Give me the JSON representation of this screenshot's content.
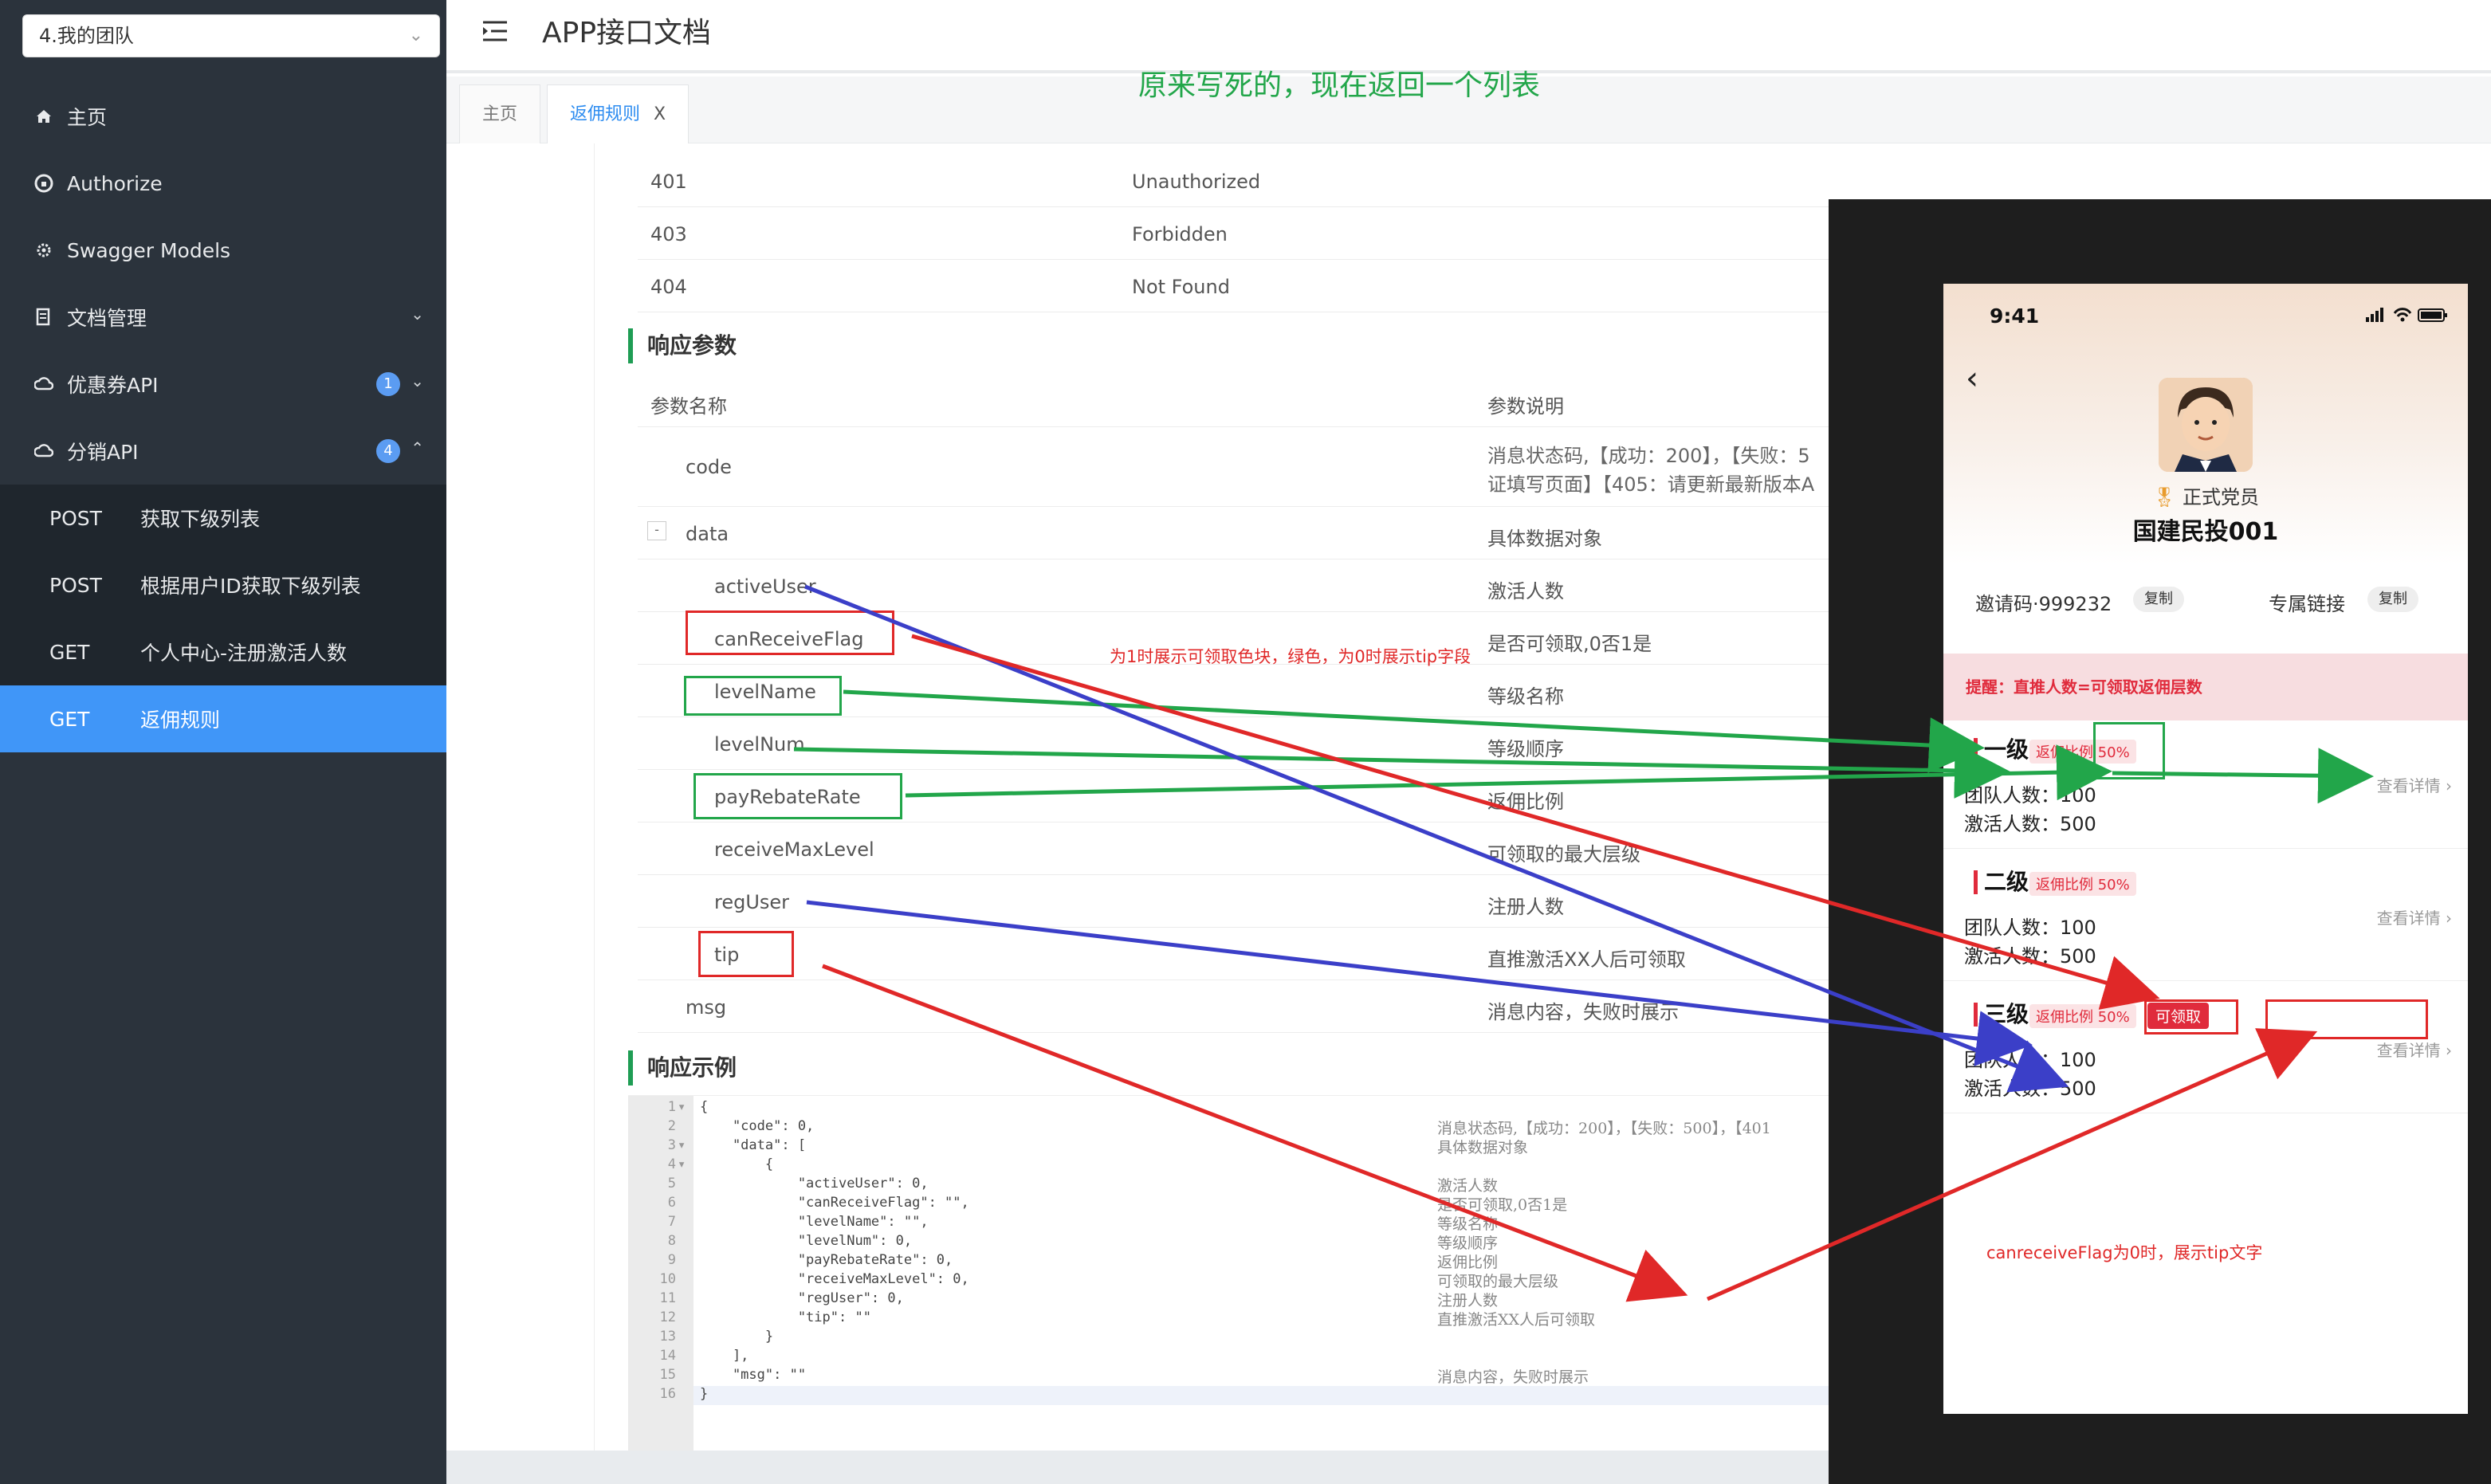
{
  "sidebar": {
    "team_select": "4.我的团队",
    "items": [
      {
        "label": "主页"
      },
      {
        "label": "Authorize"
      },
      {
        "label": "Swagger Models"
      },
      {
        "label": "文档管理"
      },
      {
        "label": "优惠券API",
        "badge": "1"
      },
      {
        "label": "分销API",
        "badge": "4"
      }
    ],
    "sub_items": [
      {
        "method": "POST",
        "label": "获取下级列表"
      },
      {
        "method": "POST",
        "label": "根据用户ID获取下级列表"
      },
      {
        "method": "GET",
        "label": "个人中心-注册激活人数"
      },
      {
        "method": "GET",
        "label": "返佣规则"
      }
    ]
  },
  "header": {
    "title": "APP接口文档"
  },
  "tabs": [
    {
      "label": "主页"
    },
    {
      "label": "返佣规则",
      "close": "X"
    }
  ],
  "note_title": "原来写死的，现在返回一个列表",
  "status_codes": [
    {
      "code": "401",
      "desc": "Unauthorized"
    },
    {
      "code": "403",
      "desc": "Forbidden"
    },
    {
      "code": "404",
      "desc": "Not Found"
    }
  ],
  "response_params": {
    "title": "响应参数",
    "col_name": "参数名称",
    "col_desc": "参数说明",
    "rows": [
      {
        "name": "code",
        "desc": "消息状态码,【成功：200】，【失败：5",
        "desc2": "证填写页面】【405：请更新最新版本A"
      },
      {
        "name": "data",
        "desc": "具体数据对象",
        "toggle": "-"
      },
      {
        "name": "activeUser",
        "desc": "激活人数"
      },
      {
        "name": "canReceiveFlag",
        "desc": "是否可领取,0否1是"
      },
      {
        "name": "levelName",
        "desc": "等级名称"
      },
      {
        "name": "levelNum",
        "desc": "等级顺序"
      },
      {
        "name": "payRebateRate",
        "desc": "返佣比例"
      },
      {
        "name": "receiveMaxLevel",
        "desc": "可领取的最大层级"
      },
      {
        "name": "regUser",
        "desc": "注册人数"
      },
      {
        "name": "tip",
        "desc": "直推激活XX人后可领取"
      },
      {
        "name": "msg",
        "desc": "消息内容，失败时展示"
      }
    ]
  },
  "response_example": {
    "title": "响应示例",
    "lines": [
      {
        "n": "1",
        "fold": "▾",
        "code": "{",
        "comment": ""
      },
      {
        "n": "2",
        "fold": "",
        "code": "    \"code\": 0,",
        "comment": "消息状态码,【成功：200】，【失败：500】，【401"
      },
      {
        "n": "3",
        "fold": "▾",
        "code": "    \"data\": [",
        "comment": "具体数据对象"
      },
      {
        "n": "4",
        "fold": "▾",
        "code": "        {",
        "comment": ""
      },
      {
        "n": "5",
        "fold": "",
        "code": "            \"activeUser\": 0,",
        "comment": "激活人数"
      },
      {
        "n": "6",
        "fold": "",
        "code": "            \"canReceiveFlag\": \"\",",
        "comment": "是否可领取,0否1是"
      },
      {
        "n": "7",
        "fold": "",
        "code": "            \"levelName\": \"\",",
        "comment": "等级名称"
      },
      {
        "n": "8",
        "fold": "",
        "code": "            \"levelNum\": 0,",
        "comment": "等级顺序"
      },
      {
        "n": "9",
        "fold": "",
        "code": "            \"payRebateRate\": 0,",
        "comment": "返佣比例"
      },
      {
        "n": "10",
        "fold": "",
        "code": "            \"receiveMaxLevel\": 0,",
        "comment": "可领取的最大层级"
      },
      {
        "n": "11",
        "fold": "",
        "code": "            \"regUser\": 0,",
        "comment": "注册人数"
      },
      {
        "n": "12",
        "fold": "",
        "code": "            \"tip\": \"\"",
        "comment": "直推激活XX人后可领取"
      },
      {
        "n": "13",
        "fold": "",
        "code": "        }",
        "comment": ""
      },
      {
        "n": "14",
        "fold": "",
        "code": "    ],",
        "comment": ""
      },
      {
        "n": "15",
        "fold": "",
        "code": "    \"msg\": \"\"",
        "comment": "消息内容，失败时展示"
      },
      {
        "n": "16",
        "fold": "",
        "code": "}",
        "comment": ""
      }
    ]
  },
  "phone": {
    "time": "9:41",
    "rank": "正式党员",
    "name": "国建民投001",
    "invite_label": "邀请码·999232",
    "copy": "复制",
    "link_label": "专属链接",
    "tip": "提醒：直推人数=可领取返佣层数",
    "levels": [
      {
        "title": "一级",
        "rate": "返佣比例 50%",
        "team_line": "团队人数：100",
        "active_line": "激活人数：500",
        "detail": "查看详情 ›"
      },
      {
        "title": "二级",
        "rate": "返佣比例 50%",
        "team_line": "团队人数：100",
        "active_line": "激活人数：500",
        "detail": "查看详情 ›"
      },
      {
        "title": "三级",
        "rate": "返佣比例 50%",
        "team_line": "团队人数：100",
        "active_line": "激活人数：500",
        "detail": "查看详情 ›",
        "receive": "可领取"
      }
    ]
  },
  "annotations": {
    "flag_note": "为1时展示可领取色块，绿色，为0时展示tip字段",
    "tip_note": "canreceiveFlag为0时，展示tip文字"
  },
  "colors": {
    "sidebar_bg": "#2b333c",
    "active_blue": "#4096f8",
    "annotation_red": "#e02828",
    "annotation_green": "#22a64a",
    "annotation_blue": "#3b3fc8",
    "section_bar": "#1f9d54"
  }
}
